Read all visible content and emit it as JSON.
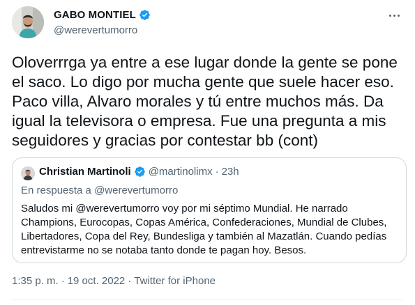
{
  "author": {
    "name": "GABO MONTIEL",
    "handle": "@werevertumorro",
    "verified_icon": "verified-badge-icon"
  },
  "more_icon": "more-options-icon",
  "tweet": {
    "text": "Oloverrrga ya entre a ese lugar donde la gente se pone\nel saco. Lo digo por mucha gente que suele hacer eso.\nPaco villa, Alvaro morales y tú entre muchos más. Da\nigual la televisora o empresa. Fue una pregunta a mis\nseguidores y gracias por contestar bb (cont)"
  },
  "quote": {
    "name": "Christian Martinoli",
    "handle": "@martinolimx",
    "separator": "·",
    "time": "23h",
    "reply_to": "En respuesta a @werevertumorro",
    "text": "Saludos mi @werevertumorro voy por mi séptimo Mundial. He narrado Champions, Eurocopas, Copas América, Confederaciones, Mundial de Clubes, Libertadores, Copa del Rey, Bundesliga y también al Mazatlán. Cuando pedías entrevistarme no se notaba tanto donde te pagan hoy. Besos."
  },
  "meta": {
    "time": "1:35 p. m.",
    "sep1": "·",
    "date": "19 oct. 2022",
    "sep2": "·",
    "source": "Twitter for iPhone"
  },
  "colors": {
    "verified": "#1d9bf0",
    "secondary_text": "#536471",
    "primary_text": "#0f1419",
    "border": "#cfd9de"
  }
}
